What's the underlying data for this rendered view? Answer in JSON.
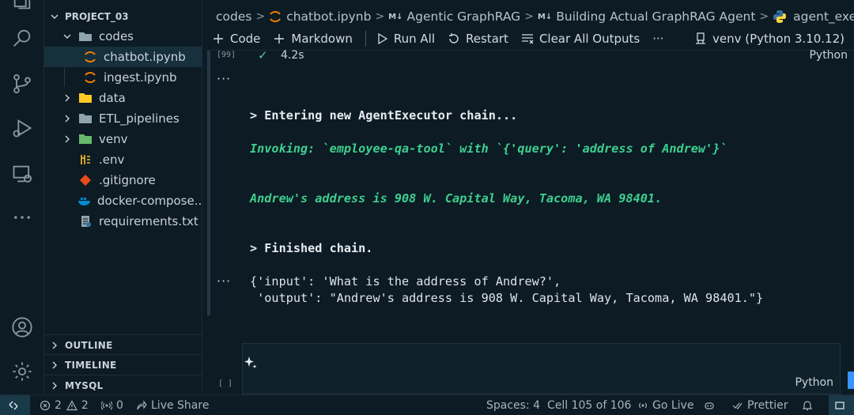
{
  "explorer": {
    "project": "PROJECT_03",
    "items": [
      {
        "label": "codes",
        "icon": "folder-open-icon"
      },
      {
        "label": "chatbot.ipynb",
        "icon": "jupyter-icon"
      },
      {
        "label": "ingest.ipynb",
        "icon": "jupyter-icon"
      },
      {
        "label": "data",
        "icon": "folder-icon"
      },
      {
        "label": "ETL_pipelines",
        "icon": "folder-icon"
      },
      {
        "label": "venv",
        "icon": "folder-icon"
      },
      {
        "label": ".env",
        "icon": "env-icon"
      },
      {
        "label": ".gitignore",
        "icon": "git-icon"
      },
      {
        "label": "docker-compose....",
        "icon": "docker-icon"
      },
      {
        "label": "requirements.txt",
        "icon": "requirements-icon"
      }
    ],
    "sections": [
      "OUTLINE",
      "TIMELINE",
      "MYSQL"
    ]
  },
  "breadcrumb": [
    "codes",
    "chatbot.ipynb",
    "Agentic GraphRAG",
    "Building Actual GraphRAG Agent",
    "agent_executor.invoke"
  ],
  "toolbar": {
    "code": "Code",
    "markdown": "Markdown",
    "run_all": "Run All",
    "restart": "Restart",
    "clear": "Clear All Outputs",
    "more": "···",
    "kernel": "venv (Python 3.10.12)"
  },
  "cell": {
    "exec_count": "[99]",
    "duration": "4.2s",
    "language": "Python",
    "output_menu": "···",
    "output_menu2": "···",
    "lines": {
      "entering": "> Entering new AgentExecutor chain...",
      "invoking": "Invoking: `employee-qa-tool` with `{'query': 'address of Andrew'}`",
      "answer": "Andrew's address is 908 W. Capital Way, Tacoma, WA 98401.",
      "finished": "> Finished chain.",
      "result1": "{'input': 'What is the address of Andrew?',",
      "result2": " 'output': \"Andrew's address is 908 W. Capital Way, Tacoma, WA 98401.\"}"
    }
  },
  "next_cell": {
    "exec_count": "[ ]",
    "language": "Python"
  },
  "status": {
    "errors": "2",
    "warnings": "2",
    "ports": "0",
    "live_share": "Live Share",
    "spaces": "Spaces: 4",
    "cell_pos": "Cell 105 of 106",
    "go_live": "Go Live",
    "prettier": "Prettier"
  },
  "colors": {
    "background": "#0c1b24",
    "green_output": "#3ecf8e",
    "accent_blue": "#3794ff"
  }
}
